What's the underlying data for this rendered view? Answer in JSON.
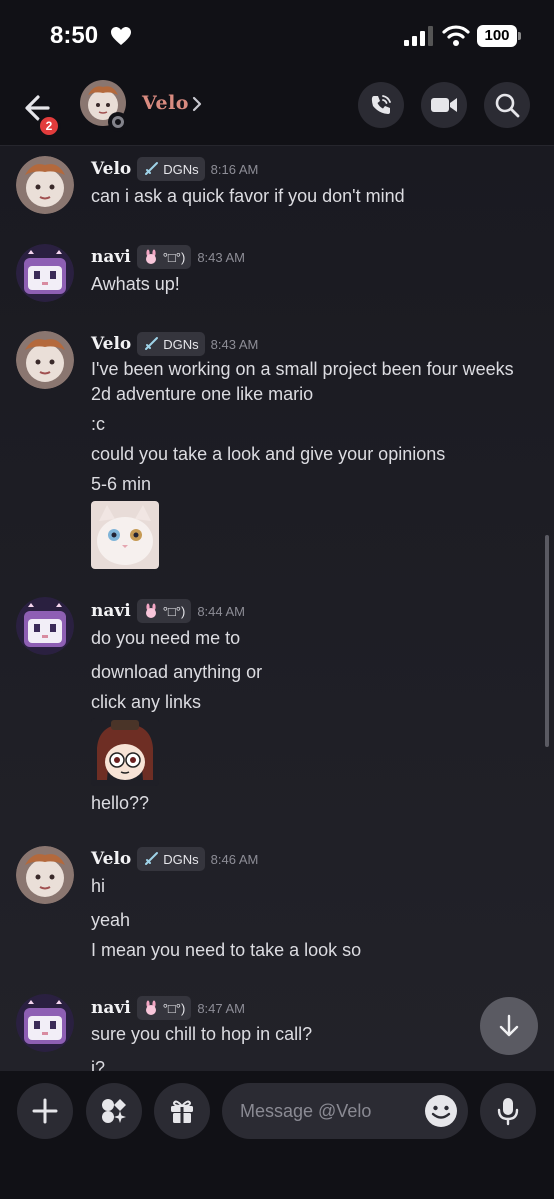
{
  "status_bar": {
    "time": "8:50",
    "battery": "100"
  },
  "header": {
    "back_badge": "2",
    "channel_name": "Velo"
  },
  "messages": [
    {
      "author": "Velo",
      "tag": "DGNs",
      "time": "8:16 AM",
      "lines": [
        "can i ask a quick favor if you don't mind"
      ]
    },
    {
      "author": "navi",
      "tag": "°□°)",
      "time": "8:43 AM",
      "lines": [
        "Awhats up!"
      ]
    },
    {
      "author": "Velo",
      "tag": "DGNs",
      "time": "8:43 AM",
      "lines": [
        "I've been working on a small project been four weeks",
        "2d adventure one like mario",
        ":c",
        "could you take a look and give your opinions",
        "5-6 min"
      ]
    },
    {
      "author": "navi",
      "tag": "°□°)",
      "time": "8:44 AM",
      "lines": [
        "do you need me to",
        "download anything or",
        "click any links",
        "hello??"
      ]
    },
    {
      "author": "Velo",
      "tag": "DGNs",
      "time": "8:46 AM",
      "lines": [
        "hi",
        "yeah",
        "I mean you need to take a look so"
      ]
    },
    {
      "author": "navi",
      "tag": "°□°)",
      "time": "8:47 AM",
      "lines": [
        "sure you chill to hop in call?",
        "i?"
      ]
    }
  ],
  "composer": {
    "placeholder": "Message @Velo"
  },
  "icons": {
    "back": "arrow-left-icon",
    "voice_call": "phone-icon",
    "video_call": "video-camera-icon",
    "search": "search-icon",
    "add": "plus-icon",
    "apps": "apps-icon",
    "gift": "gift-icon",
    "emoji": "emoji-icon",
    "mic": "microphone-icon",
    "jump": "arrow-down-icon"
  },
  "colors": {
    "background": "#1a1a21",
    "unread_badge": "#e23c3c",
    "velo_name": "#d98b80"
  }
}
